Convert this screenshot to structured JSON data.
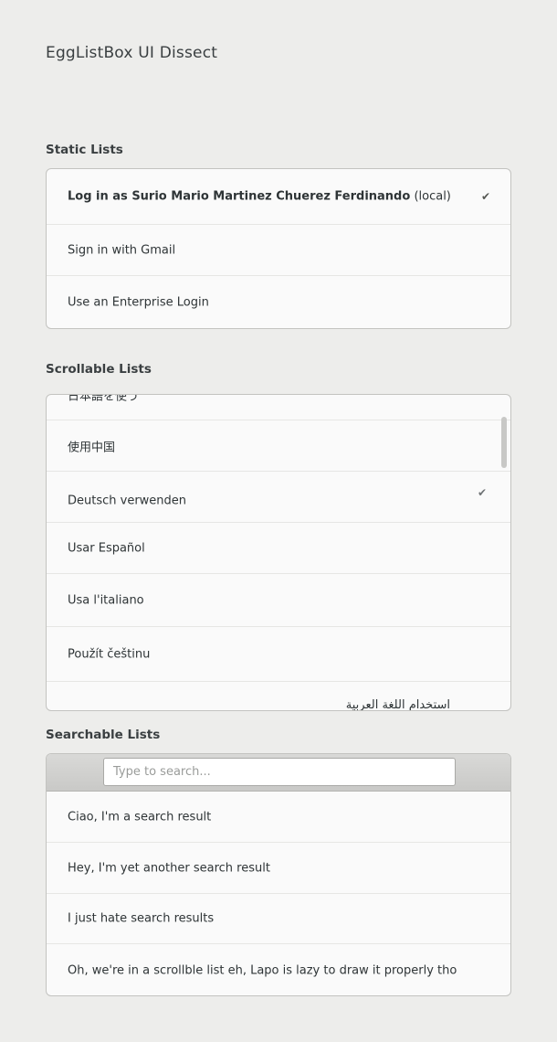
{
  "window": {
    "title": "EggListBox UI Dissect"
  },
  "static_lists": {
    "title": "Static Lists",
    "rows": [
      {
        "bold": "Log in as Surio Mario Martinez Chuerez Ferdinando",
        "normal": " (local)",
        "checked": true
      },
      {
        "bold": "",
        "normal": "Sign in with Gmail",
        "checked": false
      },
      {
        "bold": "",
        "normal": "Use an Enterprise Login",
        "checked": false
      }
    ],
    "check_glyph": "✔"
  },
  "scrollable_lists": {
    "title": "Scrollable Lists",
    "rows": [
      {
        "label": "日本語を使う"
      },
      {
        "label": "使用中国"
      },
      {
        "label": "Deutsch verwenden",
        "checked": true
      },
      {
        "label": "Usar Español"
      },
      {
        "label": "Usa l'italiano"
      },
      {
        "label": "Použít češtinu"
      },
      {
        "label": "استخدام اللغة العربية"
      }
    ],
    "check_glyph": "✔"
  },
  "searchable_lists": {
    "title": "Searchable Lists",
    "search_placeholder": "Type to search...",
    "search_value": "",
    "rows": [
      {
        "label": "Ciao, I'm a search result"
      },
      {
        "label": "Hey, I'm yet another search result"
      },
      {
        "label": "I just hate search results"
      },
      {
        "label": "Oh, we're in a scrollble list eh, Lapo is lazy to draw it properly tho"
      }
    ]
  }
}
